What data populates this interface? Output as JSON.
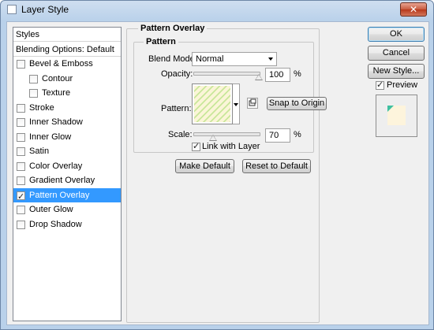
{
  "window": {
    "title": "Layer Style",
    "close_label": "✕"
  },
  "styles_panel": {
    "header": "Styles",
    "blending_options": "Blending Options: Default",
    "items": [
      {
        "label": "Bevel & Emboss",
        "checked": false,
        "indent": false
      },
      {
        "label": "Contour",
        "checked": false,
        "indent": true
      },
      {
        "label": "Texture",
        "checked": false,
        "indent": true
      },
      {
        "label": "Stroke",
        "checked": false,
        "indent": false
      },
      {
        "label": "Inner Shadow",
        "checked": false,
        "indent": false
      },
      {
        "label": "Inner Glow",
        "checked": false,
        "indent": false
      },
      {
        "label": "Satin",
        "checked": false,
        "indent": false
      },
      {
        "label": "Color Overlay",
        "checked": false,
        "indent": false
      },
      {
        "label": "Gradient Overlay",
        "checked": false,
        "indent": false
      },
      {
        "label": "Pattern Overlay",
        "checked": true,
        "indent": false,
        "selected": true
      },
      {
        "label": "Outer Glow",
        "checked": false,
        "indent": false
      },
      {
        "label": "Drop Shadow",
        "checked": false,
        "indent": false
      }
    ]
  },
  "pattern_overlay": {
    "section_title": "Pattern Overlay",
    "group_title": "Pattern",
    "blend_mode_label": "Blend Mode:",
    "blend_mode_value": "Normal",
    "opacity_label": "Opacity:",
    "opacity_value": "100",
    "opacity_unit": "%",
    "opacity_fraction": 1.0,
    "pattern_label": "Pattern:",
    "snap_button": "Snap to Origin",
    "scale_label": "Scale:",
    "scale_value": "70",
    "scale_unit": "%",
    "scale_fraction": 0.3,
    "link_label": "Link with Layer",
    "link_checked": true,
    "make_default": "Make Default",
    "reset_default": "Reset to Default"
  },
  "actions": {
    "ok": "OK",
    "cancel": "Cancel",
    "new_style": "New Style...",
    "preview_label": "Preview",
    "preview_checked": true
  },
  "colors": {
    "selection": "#3399ff",
    "pattern_light": "#fbf5d8",
    "pattern_stripe": "#c9e79a",
    "preview_fill": "#fdf4dc",
    "preview_corner": "#3fc0a0"
  }
}
